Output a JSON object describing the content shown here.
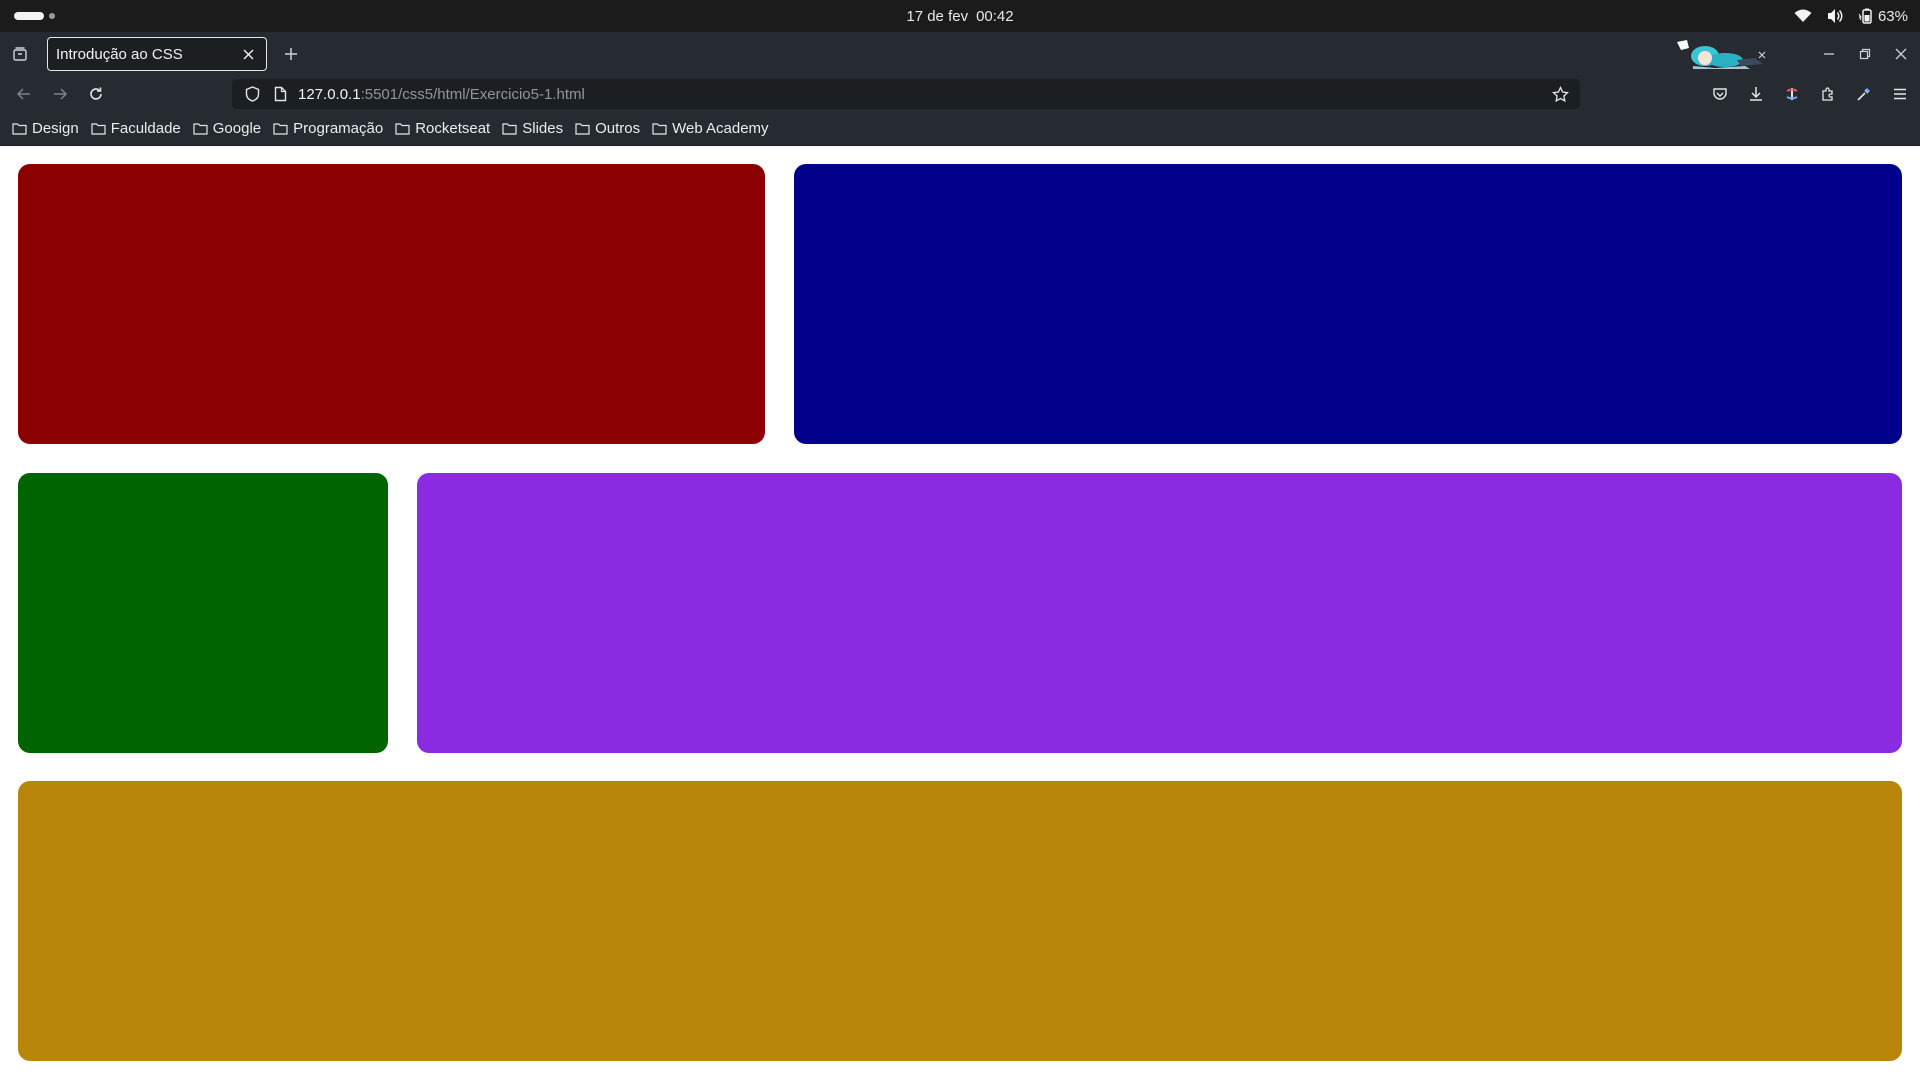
{
  "os": {
    "date": "17 de fev",
    "time": "00:42",
    "battery": "63%"
  },
  "browser": {
    "tab": {
      "title": "Introdução ao CSS"
    },
    "url": {
      "host": "127.0.0.1",
      "rest": ":5501/css5/html/Exercicio5-1.html"
    },
    "bookmarks": [
      "Design",
      "Faculdade",
      "Google",
      "Programação",
      "Rocketseat",
      "Slides",
      "Outros",
      "Web Academy"
    ]
  },
  "page": {
    "boxes": [
      {
        "name": "red-box",
        "color": "#8b0000"
      },
      {
        "name": "blue-box",
        "color": "#00008b"
      },
      {
        "name": "green-box",
        "color": "#006400"
      },
      {
        "name": "purple-box",
        "color": "#8a2be2"
      },
      {
        "name": "gold-box",
        "color": "#b8860b"
      }
    ]
  }
}
